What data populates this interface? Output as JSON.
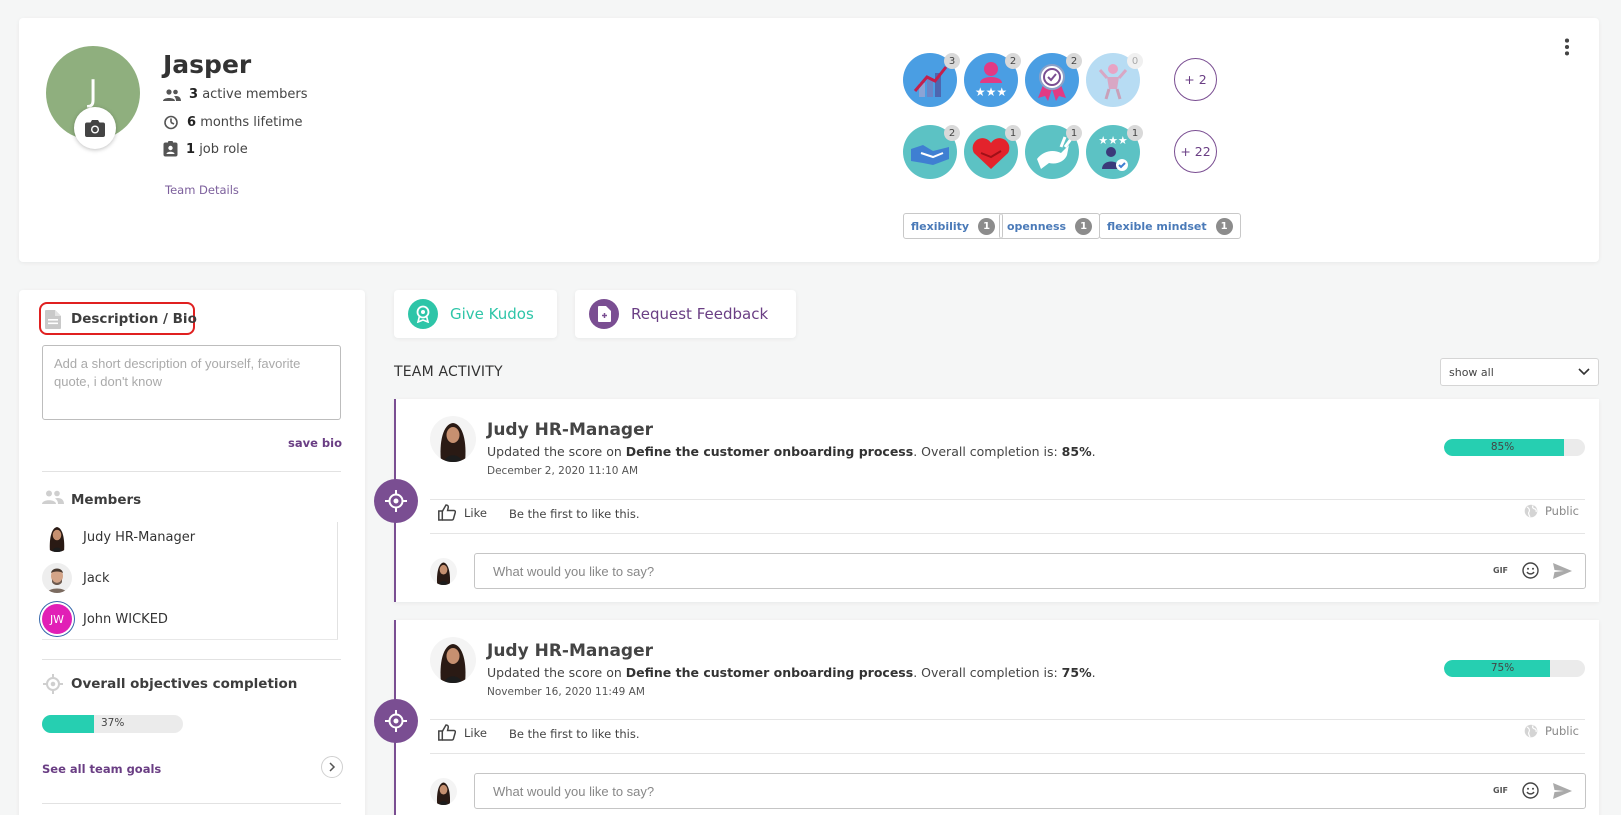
{
  "team": {
    "initial": "J",
    "name": "Jasper",
    "active_members_count": "3",
    "active_members_label": "active members",
    "lifetime_count": "6",
    "lifetime_label": "months lifetime",
    "job_role_count": "1",
    "job_role_label": "job role",
    "details_link": "Team Details"
  },
  "badges": {
    "row1": [
      {
        "icon": "growth-chart-icon",
        "count": "3"
      },
      {
        "icon": "star-person-icon",
        "count": "2"
      },
      {
        "icon": "award-ribbon-icon",
        "count": "2"
      },
      {
        "icon": "celebration-icon",
        "count": "0"
      }
    ],
    "row1_more": "+ 2",
    "row2": [
      {
        "icon": "handshake-icon",
        "count": "2"
      },
      {
        "icon": "heart-handshake-icon",
        "count": "1"
      },
      {
        "icon": "jumping-rabbit-icon",
        "count": "1"
      },
      {
        "icon": "rated-person-icon",
        "count": "1"
      }
    ],
    "row2_more": "+ 22",
    "tags": [
      {
        "label": "flexibility",
        "count": "1"
      },
      {
        "label": "openness",
        "count": "1"
      },
      {
        "label": "flexible mindset",
        "count": "1"
      }
    ]
  },
  "bio": {
    "title": "Description / Bio",
    "placeholder": "Add a short description of yourself, favorite quote, i don't know",
    "save_label": "save bio"
  },
  "members": {
    "title": "Members",
    "list": [
      {
        "name": "Judy HR-Manager"
      },
      {
        "name": "Jack"
      },
      {
        "name": "John WICKED",
        "initials": "JW"
      }
    ]
  },
  "objectives": {
    "title": "Overall objectives completion",
    "progress": 37,
    "progress_label": "37%",
    "see_all": "See all team goals"
  },
  "actions": {
    "give_kudos": "Give Kudos",
    "request_feedback": "Request Feedback"
  },
  "activity": {
    "title": "TEAM ACTIVITY",
    "filter": "show all",
    "items": [
      {
        "author": "Judy HR-Manager",
        "text_prefix": "Updated the score on ",
        "goal": "Define the customer onboarding process",
        "text_mid": ". Overall completion is: ",
        "completion": "85%",
        "text_suffix": ".",
        "progress": 85,
        "date": "December 2, 2020 11:10 AM",
        "like": "Like",
        "like_hint": "Be the first to like this.",
        "visibility": "Public",
        "comment_placeholder": "What would you like to say?",
        "gif": "GIF"
      },
      {
        "author": "Judy HR-Manager",
        "text_prefix": "Updated the score on ",
        "goal": "Define the customer onboarding process",
        "text_mid": ". Overall completion is: ",
        "completion": "75%",
        "text_suffix": ".",
        "progress": 75,
        "date": "November 16, 2020 11:49 AM",
        "like": "Like",
        "like_hint": "Be the first to like this.",
        "visibility": "Public",
        "comment_placeholder": "What would you like to say?",
        "gif": "GIF"
      }
    ]
  },
  "colors": {
    "accent_purple": "#7a4e92",
    "accent_teal": "#26cfb1",
    "highlight_red": "#e02020"
  }
}
